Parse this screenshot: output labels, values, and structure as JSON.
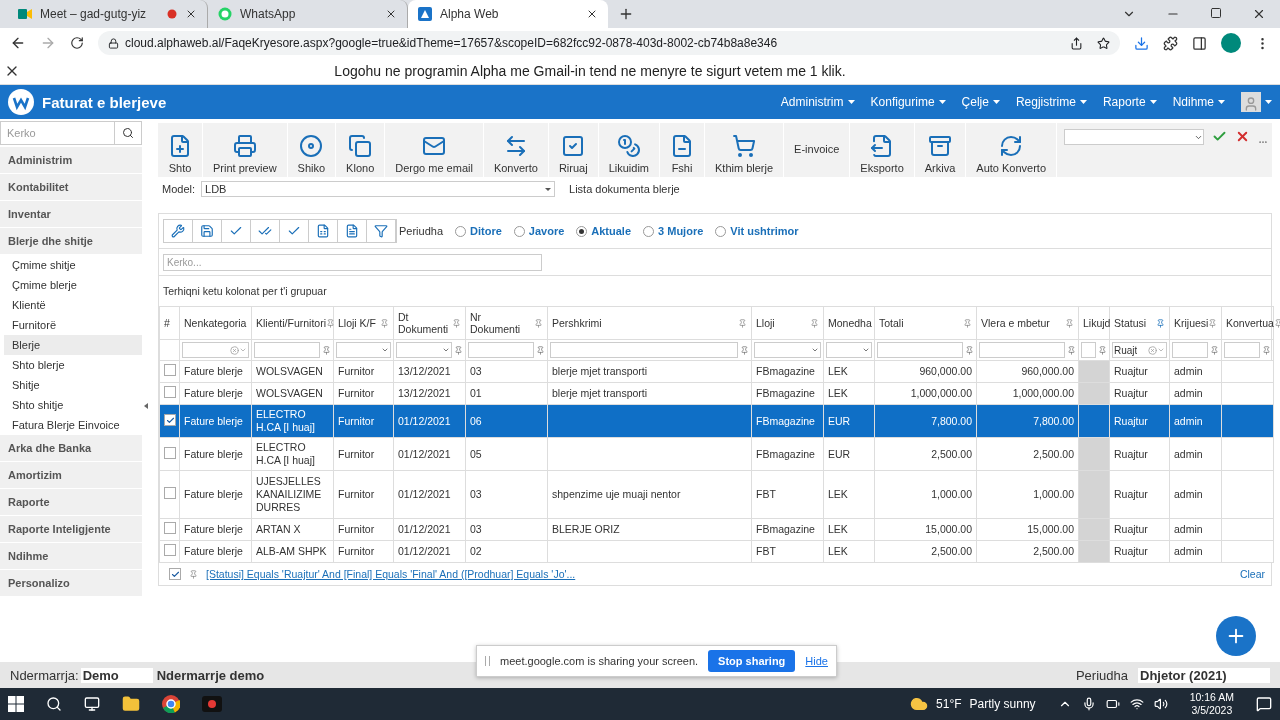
{
  "browser": {
    "tabs": [
      {
        "title": "Meet – gad-gutg-yiz",
        "kind": "meet",
        "selected": false
      },
      {
        "title": "WhatsApp",
        "kind": "whatsapp",
        "selected": false
      },
      {
        "title": "Alpha Web",
        "kind": "app",
        "selected": true
      }
    ],
    "url": "cloud.alphaweb.al/FaqeKryesore.aspx?google=true&idTheme=17657&scopeID=682fcc92-0878-403d-8002-cb74b8a8e346"
  },
  "banner": "Logohu ne programin Alpha me Gmail-in tend ne menyre te sigurt vetem me 1 klik.",
  "app": {
    "title": "Faturat e blerjeve",
    "menu": [
      "Administrim",
      "Konfigurime",
      "Çelje",
      "Regjistrime",
      "Raporte",
      "Ndihme"
    ]
  },
  "sidebar": {
    "search_placeholder": "Kerko",
    "sections": [
      {
        "label": "Administrim"
      },
      {
        "label": "Kontabilitet"
      },
      {
        "label": "Inventar"
      },
      {
        "label": "Blerje dhe shitje",
        "children": [
          {
            "label": "Çmime shitje",
            "selected": false
          },
          {
            "label": "Çmime blerje",
            "selected": false
          },
          {
            "label": "Klientë",
            "selected": false
          },
          {
            "label": "Furnitorë",
            "selected": false
          },
          {
            "label": "Blerje",
            "selected": true
          },
          {
            "label": "Shto blerje",
            "selected": false
          },
          {
            "label": "Shitje",
            "selected": false
          },
          {
            "label": "Shto shitje",
            "selected": false
          },
          {
            "label": "Fatura Blerje Einvoice",
            "selected": false
          }
        ]
      },
      {
        "label": "Arka dhe Banka"
      },
      {
        "label": "Amortizim"
      },
      {
        "label": "Raporte"
      },
      {
        "label": "Raporte Inteligjente"
      },
      {
        "label": "Ndihme"
      },
      {
        "label": "Personalizo"
      }
    ]
  },
  "toolbar": [
    {
      "label": "Shto",
      "kind": "icon"
    },
    {
      "label": "Print preview",
      "kind": "icon"
    },
    {
      "label": "Shiko",
      "kind": "icon"
    },
    {
      "label": "Klono",
      "kind": "icon"
    },
    {
      "label": "Dergo me email",
      "kind": "icon"
    },
    {
      "label": "Konverto",
      "kind": "icon"
    },
    {
      "label": "Riruaj",
      "kind": "icon"
    },
    {
      "label": "Likuidim",
      "kind": "icon"
    },
    {
      "label": "Fshi",
      "kind": "icon"
    },
    {
      "label": "Kthim blerje",
      "kind": "icon"
    },
    {
      "label": "E-invoice",
      "kind": "text"
    },
    {
      "label": "Eksporto",
      "kind": "icon"
    },
    {
      "label": "Arkiva",
      "kind": "icon"
    },
    {
      "label": "Auto Konverto",
      "kind": "icon"
    }
  ],
  "model": {
    "label": "Model:",
    "value": "LDB",
    "list_title": "Lista dokumenta blerje"
  },
  "period": {
    "label": "Periudha",
    "options": [
      {
        "label": "Ditore",
        "selected": false
      },
      {
        "label": "Javore",
        "selected": false
      },
      {
        "label": "Aktuale",
        "selected": true
      },
      {
        "label": "3 Mujore",
        "selected": false
      },
      {
        "label": "Vit ushtrimor",
        "selected": false
      }
    ]
  },
  "grid": {
    "search_placeholder": "Kerko...",
    "group_hint": "Terhiqni ketu kolonat per t'i grupuar",
    "columns": [
      {
        "title": "#",
        "kind": "check"
      },
      {
        "title": "Nenkategoria",
        "kind": "text",
        "filter": {
          "kind": "clear-combo"
        }
      },
      {
        "title": "Klienti/Furnitori",
        "kind": "text",
        "filter": {
          "kind": "text"
        }
      },
      {
        "title": "Lloji K/F",
        "kind": "text",
        "filter": {
          "kind": "combo"
        }
      },
      {
        "title": "Dt Dokumenti",
        "kind": "text",
        "filter": {
          "kind": "combo-pin"
        }
      },
      {
        "title": "Nr Dokumenti",
        "kind": "text",
        "filter": {
          "kind": "text"
        }
      },
      {
        "title": "Pershkrimi",
        "kind": "text",
        "filter": {
          "kind": "text"
        }
      },
      {
        "title": "Lloji",
        "kind": "text",
        "filter": {
          "kind": "combo"
        }
      },
      {
        "title": "Monedha",
        "kind": "text",
        "filter": {
          "kind": "combo"
        }
      },
      {
        "title": "Totali",
        "kind": "number",
        "filter": {
          "kind": "text"
        }
      },
      {
        "title": "Vlera e mbetur",
        "kind": "number",
        "filter": {
          "kind": "text"
        }
      },
      {
        "title": "Likujd",
        "kind": "shade",
        "filter": {
          "kind": "text"
        }
      },
      {
        "title": "Statusi",
        "kind": "text",
        "filter": {
          "kind": "clear-combo",
          "value": "Ruajt"
        }
      },
      {
        "title": "Krijuesi",
        "kind": "text",
        "filter": {
          "kind": "text"
        }
      },
      {
        "title": "Konvertua",
        "kind": "text",
        "filter": {
          "kind": "text"
        }
      }
    ],
    "rows": [
      {
        "selected": false,
        "cells": [
          "",
          "Fature blerje",
          "WOLSVAGEN",
          "Furnitor",
          "13/12/2021",
          "03",
          "blerje mjet transporti",
          "FBmagazine",
          "LEK",
          "960,000.00",
          "960,000.00",
          "",
          "Ruajtur",
          "admin",
          ""
        ]
      },
      {
        "selected": false,
        "cells": [
          "",
          "Fature blerje",
          "WOLSVAGEN",
          "Furnitor",
          "13/12/2021",
          "01",
          "blerje mjet transporti",
          "FBmagazine",
          "LEK",
          "1,000,000.00",
          "1,000,000.00",
          "",
          "Ruajtur",
          "admin",
          ""
        ]
      },
      {
        "selected": true,
        "cells": [
          "",
          "Fature blerje",
          "ELECTRO H.CA [I huaj]",
          "Furnitor",
          "01/12/2021",
          "06",
          "",
          "FBmagazine",
          "EUR",
          "7,800.00",
          "7,800.00",
          "",
          "Ruajtur",
          "admin",
          ""
        ]
      },
      {
        "selected": false,
        "cells": [
          "",
          "Fature blerje",
          "ELECTRO H.CA [I huaj]",
          "Furnitor",
          "01/12/2021",
          "05",
          "",
          "FBmagazine",
          "EUR",
          "2,500.00",
          "2,500.00",
          "",
          "Ruajtur",
          "admin",
          ""
        ]
      },
      {
        "selected": false,
        "cells": [
          "",
          "Fature blerje",
          "UJESJELLES KANAILIZIME DURRES",
          "Furnitor",
          "01/12/2021",
          "03",
          "shpenzime uje muaji nentor",
          "FBT",
          "LEK",
          "1,000.00",
          "1,000.00",
          "",
          "Ruajtur",
          "admin",
          ""
        ]
      },
      {
        "selected": false,
        "cells": [
          "",
          "Fature blerje",
          "ARTAN X",
          "Furnitor",
          "01/12/2021",
          "03",
          "BLERJE ORIZ",
          "FBmagazine",
          "LEK",
          "15,000.00",
          "15,000.00",
          "",
          "Ruajtur",
          "admin",
          ""
        ]
      },
      {
        "selected": false,
        "cells": [
          "",
          "Fature blerje",
          "ALB-AM SHPK",
          "Furnitor",
          "01/12/2021",
          "02",
          "",
          "FBT",
          "LEK",
          "2,500.00",
          "2,500.00",
          "",
          "Ruajtur",
          "admin",
          ""
        ]
      }
    ],
    "filter": {
      "checked": true,
      "expression": "[Statusi] Equals 'Ruajtur' And [Final] Equals 'Final' And ([Prodhuar] Equals 'Jo'...",
      "clear": "Clear"
    }
  },
  "share": {
    "text": "meet.google.com is sharing your screen.",
    "stop": "Stop sharing",
    "hide": "Hide"
  },
  "status_bar": {
    "company_label": "Ndermarrja:",
    "company_code": "Demo",
    "company_name": "Ndermarrje demo",
    "period_label": "Periudha",
    "period_value": "Dhjetor (2021)"
  },
  "taskbar": {
    "temperature": "51°F",
    "weather": "Partly sunny",
    "time": "10:16 AM",
    "date": "3/5/2023"
  }
}
